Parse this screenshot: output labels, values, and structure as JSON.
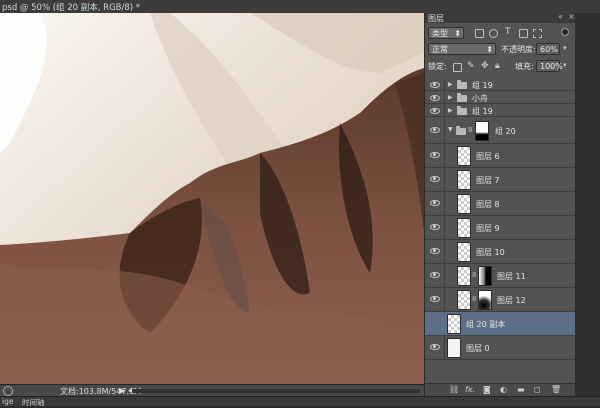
{
  "document": {
    "tab_title": "psd @ 50% (组 20 副本, RGB/8) *",
    "status_text": "文档:103.8M/547.9M"
  },
  "bottom_tabs": [
    "ige",
    "时间轴"
  ],
  "layers_panel": {
    "title": "图层",
    "filter_type": "类型",
    "blend_mode": "正常",
    "opacity_label": "不透明度:",
    "opacity_value": "60%",
    "lock_label": "锁定:",
    "fill_label": "填充:",
    "fill_value": "100%",
    "layers": [
      {
        "name": "组 19",
        "kind": "group",
        "collapsed": true
      },
      {
        "name": "小舟",
        "kind": "group",
        "collapsed": true
      },
      {
        "name": "组 19",
        "kind": "group",
        "collapsed": true
      },
      {
        "name": "组 20",
        "kind": "group-with-mask",
        "collapsed": false
      },
      {
        "name": "图层 6",
        "kind": "layer"
      },
      {
        "name": "图层 7",
        "kind": "layer"
      },
      {
        "name": "图层 8",
        "kind": "layer"
      },
      {
        "name": "图层 9",
        "kind": "layer"
      },
      {
        "name": "图层 10",
        "kind": "layer"
      },
      {
        "name": "图层 11",
        "kind": "layer-with-mask"
      },
      {
        "name": "图层 12",
        "kind": "layer-with-mask"
      },
      {
        "name": "组 20 副本",
        "kind": "merged",
        "selected": true
      },
      {
        "name": "图层 0",
        "kind": "background"
      }
    ],
    "footer_icons": [
      "link-icon",
      "fx-icon",
      "mask-icon",
      "adjustment-icon",
      "folder-icon",
      "new-layer-icon",
      "trash-icon"
    ]
  },
  "colors": {
    "panel_bg": "#535353",
    "selected_layer": "#5d6f86",
    "canvas_sky": "#f3ede7",
    "mountain_dark": "#3e2519",
    "mountain_mid": "#7a5040"
  }
}
